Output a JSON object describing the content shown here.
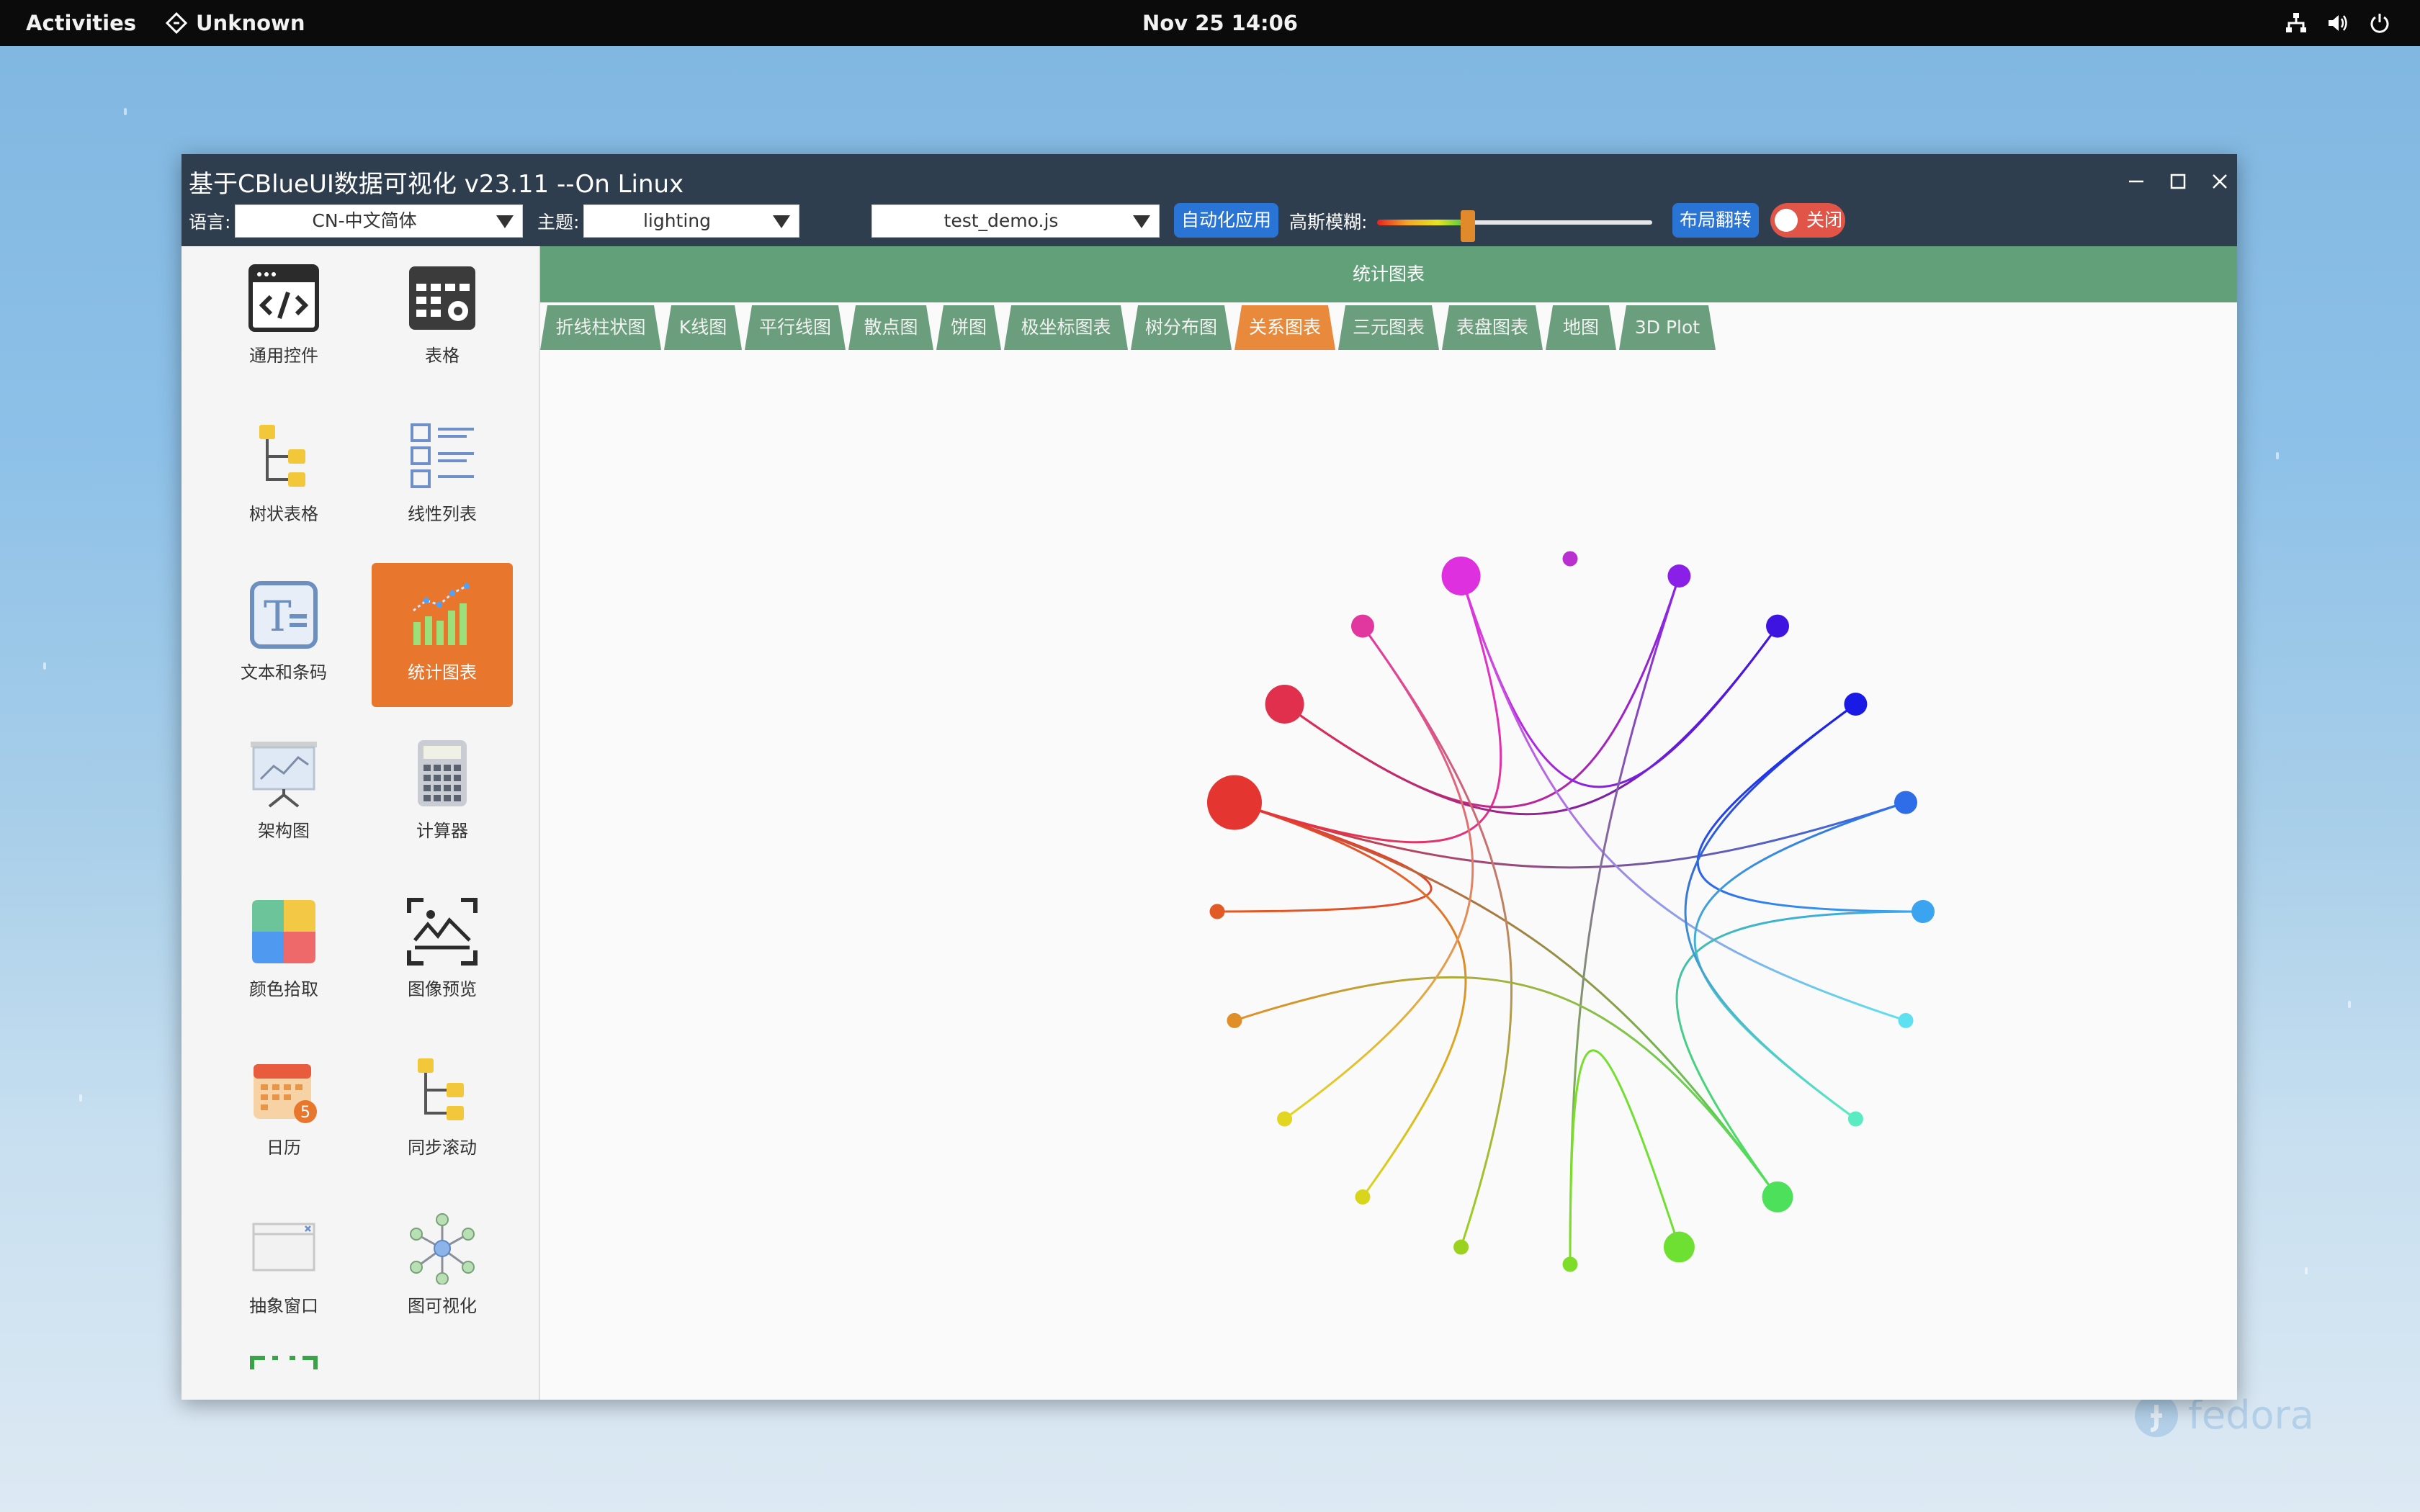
{
  "topbar": {
    "activities": "Activities",
    "app_name": "Unknown",
    "clock": "Nov 25  14:06"
  },
  "window": {
    "title": "基于CBlueUI数据可视化 v23.11 --On Linux"
  },
  "toolbar": {
    "language_label": "语言:",
    "language_value": "CN-中文简体",
    "theme_label": "主题:",
    "theme_value": "lighting",
    "script_value": "test_demo.js",
    "auto_apply_label": "自动化应用",
    "blur_label": "高斯模糊:",
    "blur_level": 0.33,
    "layout_flip_label": "布局翻转",
    "toggle_label": "关闭"
  },
  "sidebar": {
    "items": [
      {
        "label": "通用控件",
        "icon": "code-window-icon"
      },
      {
        "label": "表格",
        "icon": "table-settings-icon"
      },
      {
        "label": "树状表格",
        "icon": "tree-table-icon"
      },
      {
        "label": "线性列表",
        "icon": "linear-list-icon"
      },
      {
        "label": "文本和条码",
        "icon": "text-icon"
      },
      {
        "label": "统计图表",
        "icon": "bar-chart-icon"
      },
      {
        "label": "架构图",
        "icon": "presentation-board-icon"
      },
      {
        "label": "计算器",
        "icon": "calculator-icon"
      },
      {
        "label": "颜色拾取",
        "icon": "color-picker-icon"
      },
      {
        "label": "图像预览",
        "icon": "image-preview-icon"
      },
      {
        "label": "日历",
        "icon": "calendar-icon"
      },
      {
        "label": "同步滚动",
        "icon": "sync-scroll-icon"
      },
      {
        "label": "抽象窗口",
        "icon": "abstract-window-icon"
      },
      {
        "label": "图可视化",
        "icon": "graph-network-icon"
      }
    ],
    "active_index": 5
  },
  "main": {
    "section_title": "统计图表",
    "tabs": [
      "折线柱状图",
      "K线图",
      "平行线图",
      "散点图",
      "饼图",
      "极坐标图表",
      "树分布图",
      "关系图表",
      "三元图表",
      "表盘图表",
      "地图",
      "3D Plot"
    ],
    "selected_tab": 7
  },
  "chart_data": {
    "type": "chord-graph",
    "nodes": [
      {
        "id": 0,
        "angle": 90,
        "size": 1,
        "color": "#b92fd0"
      },
      {
        "id": 1,
        "angle": 60,
        "size": 2,
        "color": "#8a1fe8"
      },
      {
        "id": 2,
        "angle": 30,
        "size": 2,
        "color": "#3d14e0"
      },
      {
        "id": 3,
        "angle": 0,
        "size": 2,
        "color": "#1a1ae6"
      },
      {
        "id": 4,
        "angle": -30,
        "size": 2,
        "color": "#2e6ce8"
      },
      {
        "id": 5,
        "angle": -60,
        "size": 2,
        "color": "#3aa4f0"
      },
      {
        "id": 6,
        "angle": -90,
        "size": 1,
        "color": "#5de0ef"
      },
      {
        "id": 7,
        "angle": -120,
        "size": 1,
        "color": "#5aebc2"
      },
      {
        "id": 8,
        "angle": -150,
        "size": 3,
        "color": "#4de05a"
      },
      {
        "id": 9,
        "angle": -180,
        "size": 3,
        "color": "#6ee032"
      },
      {
        "id": 10,
        "angle": -210,
        "size": 1,
        "color": "#7ddd28"
      },
      {
        "id": 11,
        "angle": -240,
        "size": 1,
        "color": "#9ad21e"
      },
      {
        "id": 12,
        "angle": -270,
        "size": 1,
        "color": "#d9d41c"
      },
      {
        "id": 13,
        "angle": -300,
        "size": 1,
        "color": "#e2d620"
      },
      {
        "id": 14,
        "angle": 150,
        "size": 1,
        "color": "#e08f28"
      },
      {
        "id": 15,
        "angle": 120,
        "size": 1,
        "color": "#e25a24"
      },
      {
        "id": 16,
        "angle": 100,
        "size": 6,
        "color": "#e43530"
      },
      {
        "id": 17,
        "angle": 80,
        "size": 4,
        "color": "#e0304e"
      },
      {
        "id": 18,
        "angle": 60,
        "size": 2,
        "color": "#e0389e"
      },
      {
        "id": 19,
        "angle": 40,
        "size": 4,
        "color": "#de30de"
      }
    ],
    "links": [
      [
        16,
        4
      ],
      [
        16,
        15
      ],
      [
        16,
        8
      ],
      [
        16,
        12
      ],
      [
        16,
        19
      ],
      [
        17,
        1
      ],
      [
        17,
        2
      ],
      [
        18,
        11
      ],
      [
        19,
        2
      ],
      [
        19,
        6
      ],
      [
        1,
        10
      ],
      [
        3,
        5
      ],
      [
        4,
        7
      ],
      [
        5,
        8
      ],
      [
        14,
        8
      ],
      [
        13,
        18
      ],
      [
        9,
        10
      ],
      [
        3,
        7
      ]
    ]
  }
}
